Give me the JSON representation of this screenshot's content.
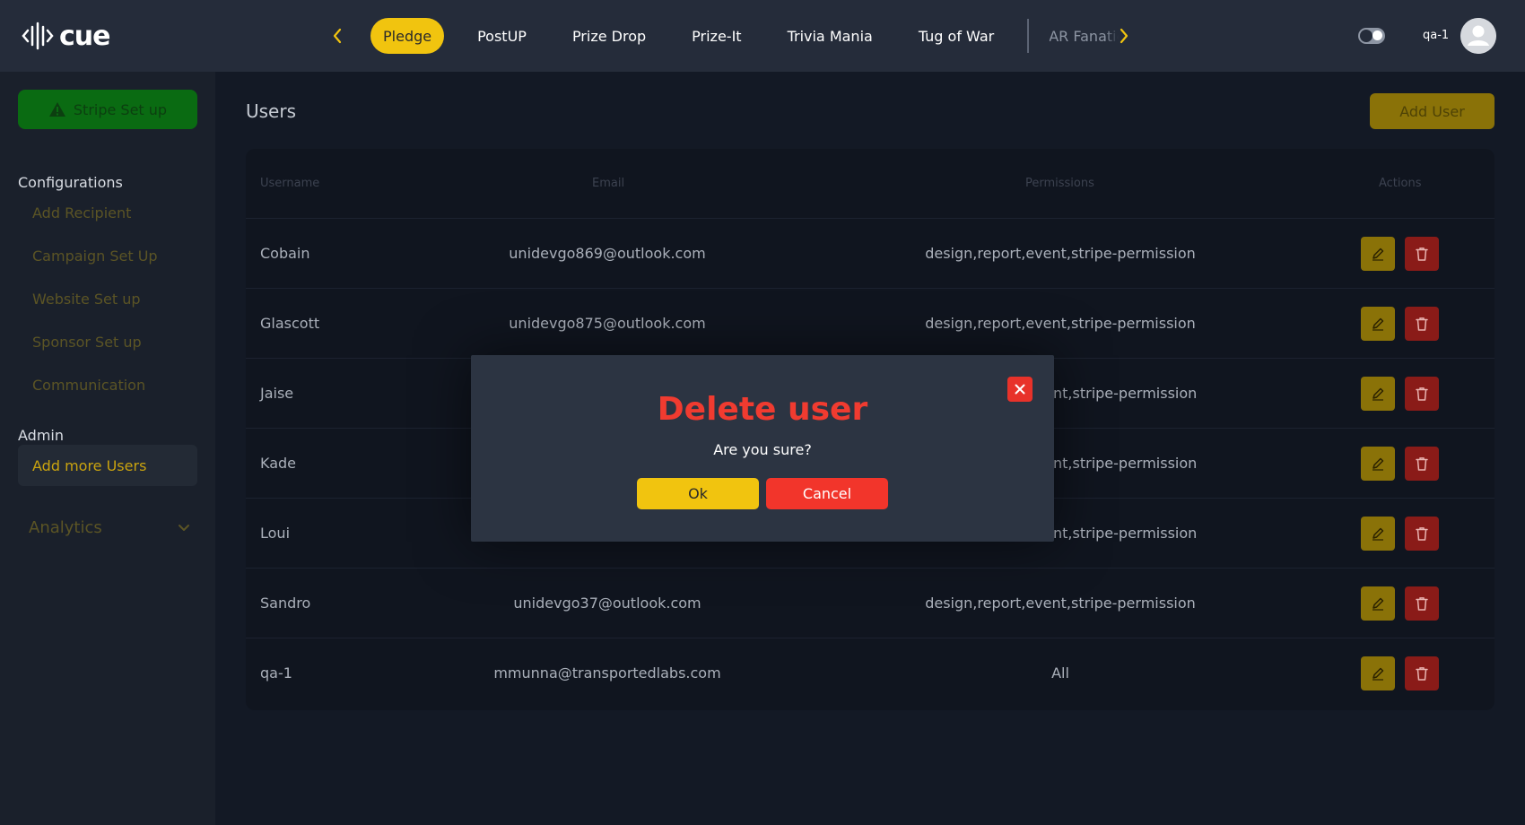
{
  "brand": {
    "name": "cue"
  },
  "header": {
    "tabs": [
      {
        "label": "Pledge",
        "active": true
      },
      {
        "label": "PostUP"
      },
      {
        "label": "Prize Drop"
      },
      {
        "label": "Prize-It"
      },
      {
        "label": "Trivia Mania"
      },
      {
        "label": "Tug of War"
      },
      {
        "label": "AR Fanatic"
      }
    ],
    "user_name": "qa-1"
  },
  "sidebar": {
    "stripe_button": "Stripe Set up",
    "configurations_heading": "Configurations",
    "configuration_items": [
      "Add Recipient",
      "Campaign Set Up",
      "Website Set up",
      "Sponsor Set up",
      "Communication"
    ],
    "admin_heading": "Admin",
    "admin_items": [
      "Add more Users"
    ],
    "analytics_label": "Analytics"
  },
  "main": {
    "title": "Users",
    "add_user_label": "Add User",
    "columns": [
      "Username",
      "Email",
      "Permissions",
      "Actions"
    ],
    "rows": [
      {
        "username": "Cobain",
        "email": "unidevgo869@outlook.com",
        "permissions": "design,report,event,stripe-permission"
      },
      {
        "username": "Glascott",
        "email": "unidevgo875@outlook.com",
        "permissions": "design,report,event,stripe-permission"
      },
      {
        "username": "Jaise",
        "email": "",
        "permissions": "nt,stripe-permission"
      },
      {
        "username": "Kade",
        "email": "",
        "permissions": "nt,stripe-permission"
      },
      {
        "username": "Loui",
        "email": "",
        "permissions": "nt,stripe-permission"
      },
      {
        "username": "Sandro",
        "email": "unidevgo37@outlook.com",
        "permissions": "design,report,event,stripe-permission"
      },
      {
        "username": "qa-1",
        "email": "mmunna@transportedlabs.com",
        "permissions": "All"
      }
    ]
  },
  "modal": {
    "title": "Delete user",
    "message": "Are you sure?",
    "ok_label": "Ok",
    "cancel_label": "Cancel"
  },
  "colors": {
    "accent_yellow": "#f1c40f",
    "danger_red": "#f2352b",
    "stripe_green": "#0a6b12",
    "background": "#131925"
  }
}
